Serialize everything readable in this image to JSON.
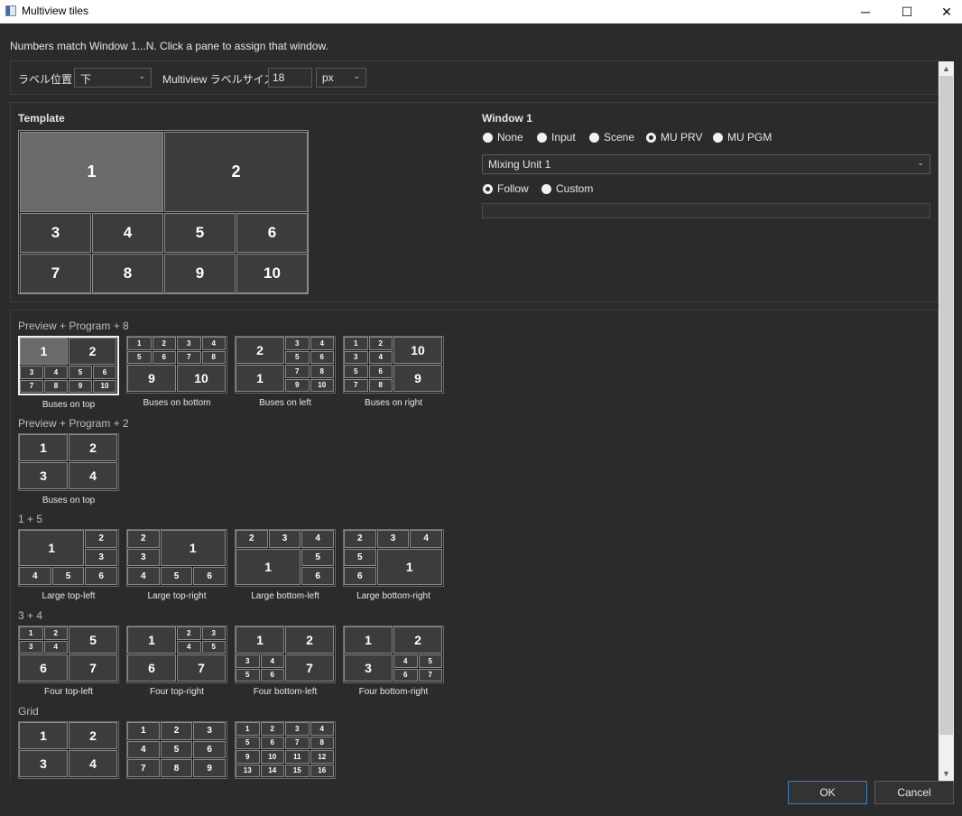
{
  "window": {
    "title": "Multiview tiles",
    "minimize_glyph": "─",
    "maximize_glyph": "☐",
    "close_glyph": "✕"
  },
  "hint": "Numbers match Window 1...N. Click a pane to assign that window.",
  "settings": {
    "label_position_label": "ラベル位置",
    "label_position_value": "下",
    "label_size_label": "Multiview ラベルサイズ",
    "label_size_value": "18",
    "unit_value": "px"
  },
  "template": {
    "heading": "Template",
    "tiles": [
      "1",
      "2",
      "3",
      "4",
      "5",
      "6",
      "7",
      "8",
      "9",
      "10"
    ]
  },
  "window_config": {
    "heading": "Window 1",
    "source_options": [
      "None",
      "Input",
      "Scene",
      "MU PRV",
      "MU PGM"
    ],
    "selected_source": "MU PRV",
    "mixing_unit_value": "Mixing Unit 1",
    "mode_options": [
      "Follow",
      "Custom"
    ],
    "selected_mode": "Follow",
    "custom_value": ""
  },
  "layouts": {
    "groups": [
      {
        "title": "Preview + Program + 8",
        "captions": [
          "Buses on top",
          "Buses on bottom",
          "Buses on left",
          "Buses on right"
        ]
      },
      {
        "title": "Preview + Program + 2",
        "captions": [
          "Buses on top"
        ]
      },
      {
        "title": "1 + 5",
        "captions": [
          "Large top-left",
          "Large top-right",
          "Large bottom-left",
          "Large bottom-right"
        ]
      },
      {
        "title": "3 + 4",
        "captions": [
          "Four top-left",
          "Four top-right",
          "Four bottom-left",
          "Four bottom-right"
        ]
      },
      {
        "title": "Grid",
        "captions": []
      }
    ]
  },
  "buttons": {
    "ok": "OK",
    "cancel": "Cancel"
  },
  "scrollbar": {
    "up_glyph": "▲",
    "down_glyph": "▼"
  },
  "colors": {
    "background": "#2b2b2b",
    "tile": "#3c3c3c",
    "selected_tile": "#6a6a6a",
    "ok_border": "#3b7bd4"
  }
}
